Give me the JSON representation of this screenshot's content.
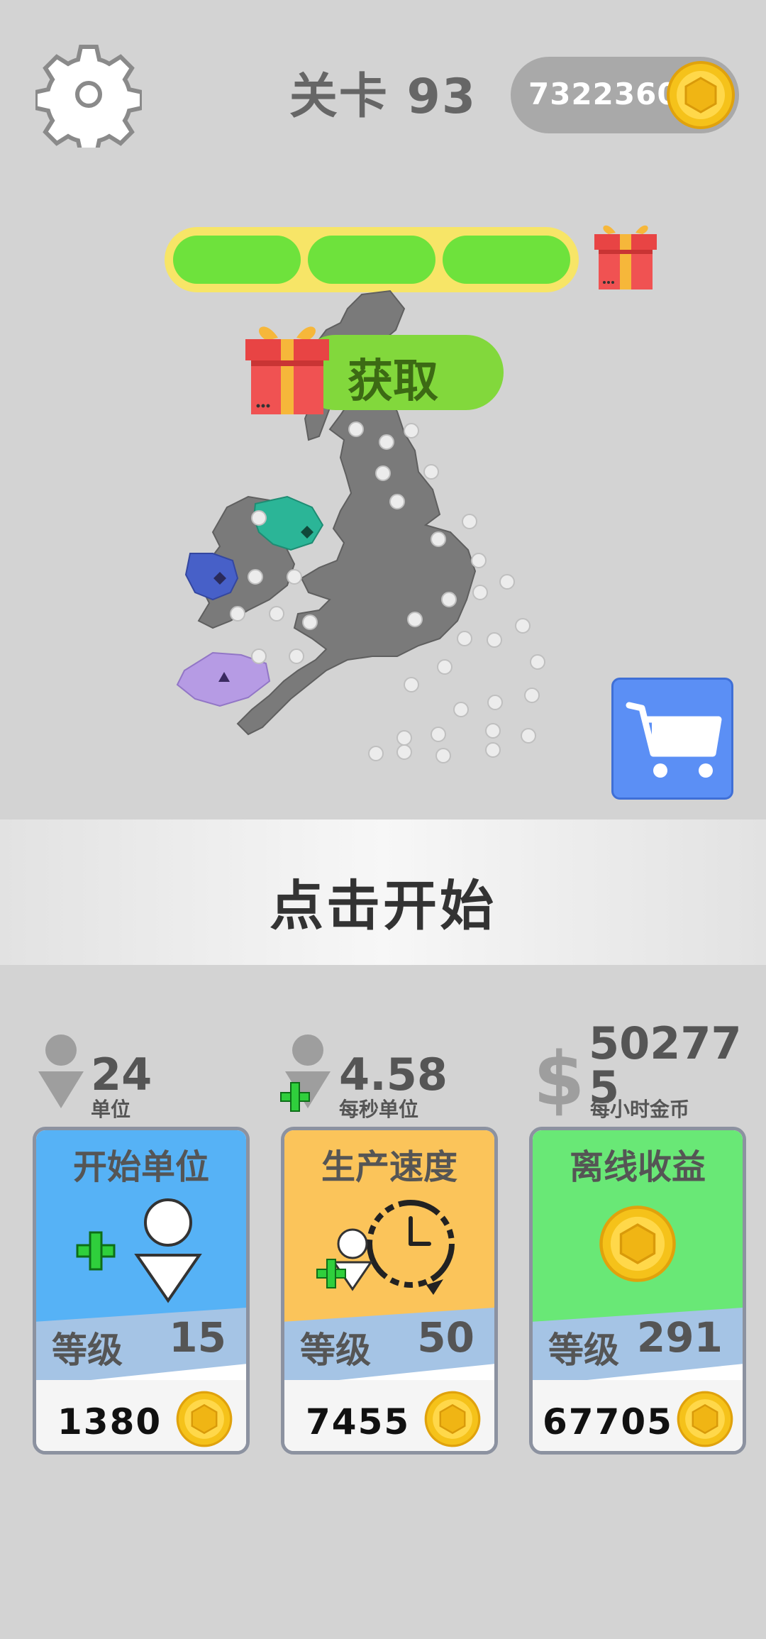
{
  "header": {
    "settings_icon": "gear-icon",
    "level_label": "关卡 93",
    "coins": "7322360",
    "coin_icon": "gold-coin-icon"
  },
  "progress": {
    "segments_filled": 3,
    "segments_total": 3,
    "fill_color": "#6ee23c",
    "track_color": "#f7e567",
    "reward_icon": "gift-icon"
  },
  "claim_button": {
    "label": "获取",
    "icon": "gift-icon"
  },
  "map": {
    "region": "British Isles",
    "captured_colors": [
      "#2bb597",
      "#4760c8",
      "#b69be4"
    ],
    "neutral_color": "#7a7a7a"
  },
  "shop_button": {
    "icon": "shopping-cart-icon",
    "color": "#5b8ff5"
  },
  "start": {
    "label": "点击开始"
  },
  "stats": [
    {
      "icon": "person-icon",
      "value": "24",
      "unit": "单位"
    },
    {
      "icon": "person-plus-icon",
      "value": "4.58",
      "unit": "每秒单位"
    },
    {
      "icon": "dollar-icon",
      "value": "502775",
      "unit": "每小时金币"
    }
  ],
  "upgrades": [
    {
      "title": "开始单位",
      "level_label": "等级",
      "level": "15",
      "cost": "1380",
      "color": "#56b2f6",
      "icon": "add-unit-icon"
    },
    {
      "title": "生产速度",
      "level_label": "等级",
      "level": "50",
      "cost": "7455",
      "color": "#fbc45a",
      "icon": "speed-clock-icon"
    },
    {
      "title": "离线收益",
      "level_label": "等级",
      "level": "291",
      "cost": "67705",
      "color": "#69e876",
      "icon": "gold-coin-icon"
    }
  ]
}
